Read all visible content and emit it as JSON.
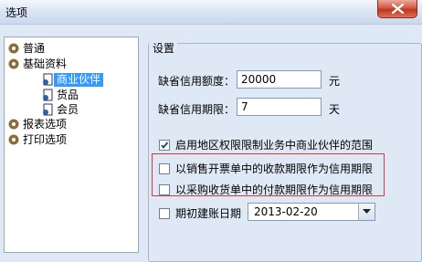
{
  "window": {
    "title": "选项"
  },
  "tree": {
    "items": [
      {
        "label": "普通",
        "level": 0
      },
      {
        "label": "基础资料",
        "level": 0
      },
      {
        "label": "商业伙伴",
        "level": 1,
        "selected": true
      },
      {
        "label": "货品",
        "level": 1
      },
      {
        "label": "会员",
        "level": 1
      },
      {
        "label": "报表选项",
        "level": 0
      },
      {
        "label": "打印选项",
        "level": 0
      }
    ]
  },
  "settings": {
    "group_title": "设置",
    "credit_limit": {
      "label": "缺省信用额度：",
      "value": "20000",
      "unit": "元"
    },
    "credit_period": {
      "label": "缺省信用期限：",
      "value": "7",
      "unit": "天"
    },
    "options": [
      {
        "label": "启用地区权限限制业务中商业伙伴的范围",
        "checked": true
      },
      {
        "label": "以销售开票单中的收款期限作为信用期限",
        "checked": false
      },
      {
        "label": "以采购收货单中的付款期限作为信用期限",
        "checked": false
      }
    ],
    "init_date": {
      "label": "期初建账日期",
      "checked": false,
      "value": "2013-02-20"
    }
  },
  "colors": {
    "selection": "#3399ff",
    "highlight_border": "#e0363b",
    "close_button": "#c2331b"
  }
}
